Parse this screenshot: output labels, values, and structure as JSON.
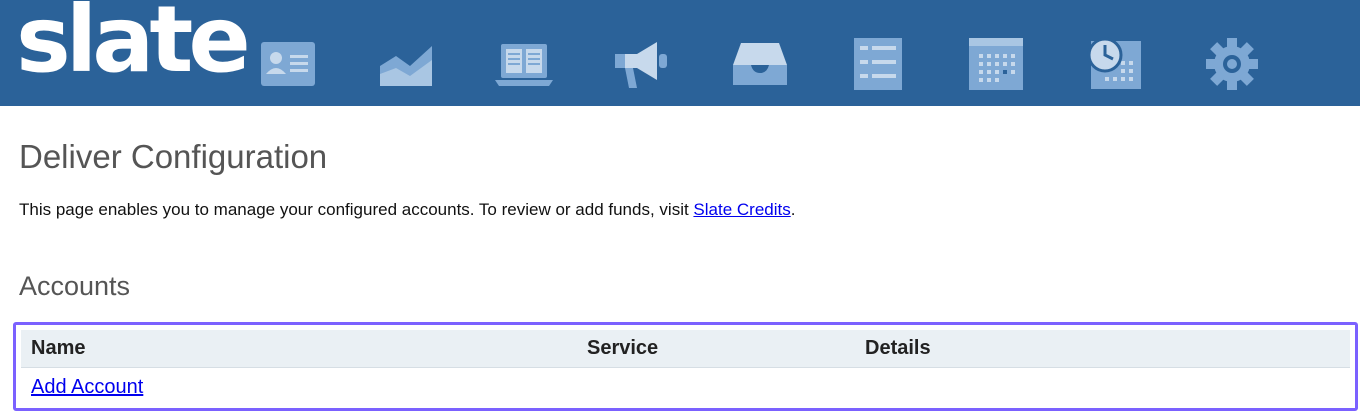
{
  "header": {
    "logo_text": "slate",
    "nav_icons": [
      "contact-card-icon",
      "area-chart-icon",
      "laptop-document-icon",
      "megaphone-icon",
      "inbox-tray-icon",
      "checklist-icon",
      "calendar-grid-icon",
      "clock-calendar-icon",
      "gear-icon"
    ],
    "colors": {
      "bar": "#2b6299",
      "icon": "#7ea8d4",
      "icon_light": "#c7d9ec"
    }
  },
  "page": {
    "title": "Deliver Configuration",
    "intro_text": "This page enables you to manage your configured accounts. To review or add funds, visit ",
    "intro_link": "Slate Credits",
    "intro_end": "."
  },
  "accounts": {
    "section_title": "Accounts",
    "columns": [
      "Name",
      "Service",
      "Details"
    ],
    "add_link": "Add Account",
    "highlight_color": "#7b61ff"
  }
}
